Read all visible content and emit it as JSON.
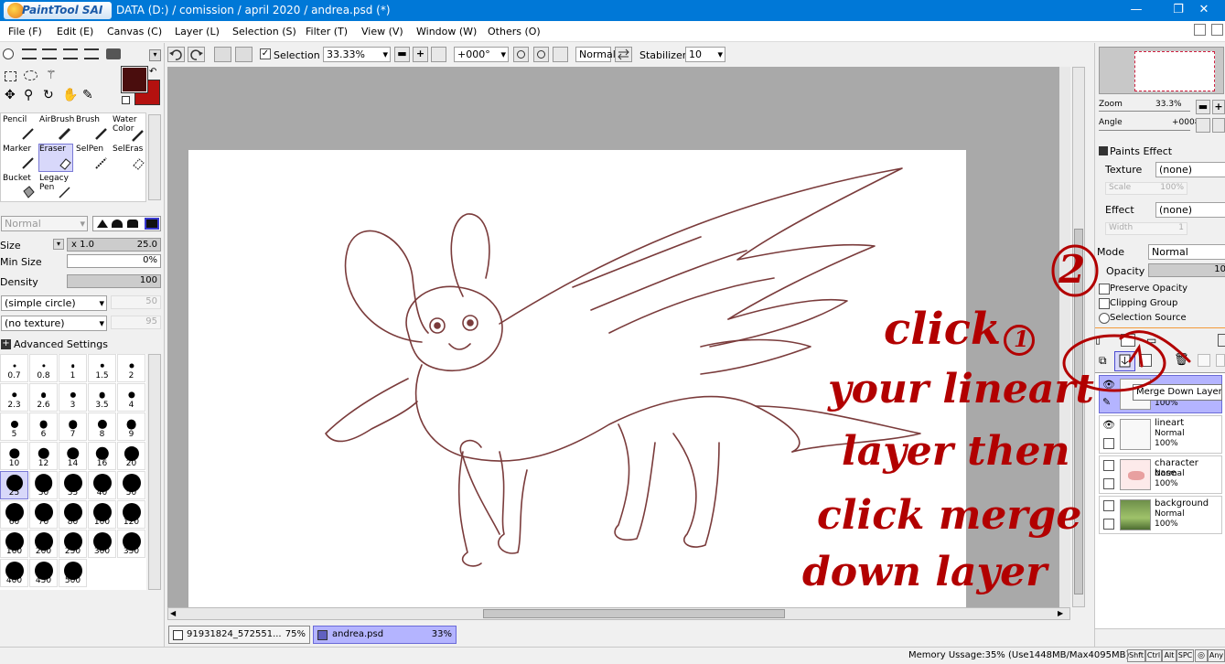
{
  "app": {
    "logo_text": "PaintTool SAI",
    "title": "DATA (D:) / comission / april 2020 / andrea.psd (*)"
  },
  "window_controls": {
    "minimize": "—",
    "maximize": "❐",
    "close": "✕"
  },
  "menu": [
    {
      "label": "File (F)"
    },
    {
      "label": "Edit (E)"
    },
    {
      "label": "Canvas (C)"
    },
    {
      "label": "Layer (L)"
    },
    {
      "label": "Selection (S)"
    },
    {
      "label": "Filter (T)"
    },
    {
      "label": "View (V)"
    },
    {
      "label": "Window (W)"
    },
    {
      "label": "Others (O)"
    }
  ],
  "toolbar": {
    "selection_label": "Selection",
    "zoom": "33.33%",
    "rotation": "+000°",
    "blend_mode": "Normal",
    "stabilizer_label": "Stabilizer",
    "stabilizer_value": "10"
  },
  "colors": {
    "primary": "#4a0d0d",
    "secondary": "#b4110f",
    "accent": "#0078d7",
    "annotation": "#b20000"
  },
  "tools": [
    {
      "label": "Pencil"
    },
    {
      "label": "AirBrush"
    },
    {
      "label": "Brush"
    },
    {
      "label": "Water Color"
    },
    {
      "label": "Marker"
    },
    {
      "label": "Eraser"
    },
    {
      "label": "SelPen"
    },
    {
      "label": "SelEras"
    },
    {
      "label": "Bucket"
    },
    {
      "label": "Legacy Pen"
    }
  ],
  "brush_settings": {
    "mode": "Normal",
    "size_label": "Size",
    "size_multiplier": "x 1.0",
    "size_value": "25.0",
    "min_size_label": "Min Size",
    "min_size_value": "0%",
    "density_label": "Density",
    "density_value": "100",
    "shape": "(simple circle)",
    "shape_value": "50",
    "texture": "(no texture)",
    "texture_value": "95",
    "advanced_label": "Advanced Settings"
  },
  "brush_sizes": [
    "0.7",
    "0.8",
    "1",
    "1.5",
    "2",
    "2.3",
    "2.6",
    "3",
    "3.5",
    "4",
    "5",
    "6",
    "7",
    "8",
    "9",
    "10",
    "12",
    "14",
    "16",
    "20",
    "25",
    "30",
    "35",
    "40",
    "50",
    "60",
    "70",
    "80",
    "100",
    "120",
    "160",
    "200",
    "250",
    "300",
    "350",
    "400",
    "450",
    "500"
  ],
  "selected_brush_size": "25",
  "navigator": {
    "zoom_label": "Zoom",
    "zoom_value": "33.3%",
    "angle_label": "Angle",
    "angle_value": "+0008"
  },
  "paints_effect": {
    "title": "Paints Effect",
    "texture_label": "Texture",
    "texture_value": "(none)",
    "scale_label": "Scale",
    "scale_value": "100%",
    "effect_label": "Effect",
    "effect_value": "(none)",
    "width_label": "Width",
    "width_value": "1"
  },
  "layer_props": {
    "mode_label": "Mode",
    "mode_value": "Normal",
    "opacity_label": "Opacity",
    "opacity_value": "10",
    "preserve_opacity": "Preserve Opacity",
    "clipping_group": "Clipping Group",
    "selection_source": "Selection Source"
  },
  "tooltip": "Merge Down Layer",
  "layers": [
    {
      "name": "",
      "mode": "",
      "opacity": "100%"
    },
    {
      "name": "lineart",
      "mode": "Normal",
      "opacity": "100%"
    },
    {
      "name": "character base",
      "mode": "Normal",
      "opacity": "100%"
    },
    {
      "name": "background",
      "mode": "Normal",
      "opacity": "100%"
    }
  ],
  "doc_tabs": [
    {
      "name": "91931824_572551...",
      "zoom": "75%"
    },
    {
      "name": "andrea.psd",
      "zoom": "33%"
    }
  ],
  "status": {
    "memory": "Memory Ussage:35% (Use1448MB/Max4095MB)",
    "keys": [
      "Shft",
      "Ctrl",
      "Alt",
      "SPC"
    ],
    "last_key": "Any"
  },
  "annotation": {
    "step2": "2",
    "step1": "1",
    "line1": "click",
    "line2": "your lineart",
    "line3": "layer then",
    "line4": "click merge",
    "line5": "down layer"
  }
}
